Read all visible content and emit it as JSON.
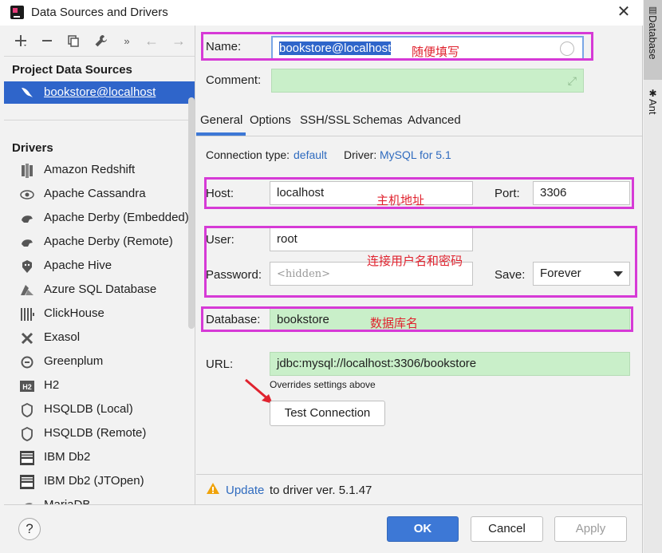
{
  "window": {
    "title": "Data Sources and Drivers"
  },
  "left": {
    "project_title": "Project Data Sources",
    "selected_source": "bookstore@localhost",
    "drivers_title": "Drivers",
    "drivers": [
      {
        "label": "Amazon Redshift",
        "icon": "redshift-icon"
      },
      {
        "label": "Apache Cassandra",
        "icon": "cassandra-icon"
      },
      {
        "label": "Apache Derby (Embedded)",
        "icon": "derby-icon"
      },
      {
        "label": "Apache Derby (Remote)",
        "icon": "derby-icon"
      },
      {
        "label": "Apache Hive",
        "icon": "hive-icon"
      },
      {
        "label": "Azure SQL Database",
        "icon": "azure-icon"
      },
      {
        "label": "ClickHouse",
        "icon": "clickhouse-icon"
      },
      {
        "label": "Exasol",
        "icon": "exasol-icon"
      },
      {
        "label": "Greenplum",
        "icon": "greenplum-icon"
      },
      {
        "label": "H2",
        "icon": "h2-icon"
      },
      {
        "label": "HSQLDB (Local)",
        "icon": "hsqldb-icon"
      },
      {
        "label": "HSQLDB (Remote)",
        "icon": "hsqldb-icon"
      },
      {
        "label": "IBM Db2",
        "icon": "db2-icon"
      },
      {
        "label": "IBM Db2 (JTOpen)",
        "icon": "db2-icon"
      },
      {
        "label": "MariaDB",
        "icon": "mariadb-icon"
      }
    ]
  },
  "form": {
    "name_label": "Name:",
    "name_value": "bookstore@localhost",
    "name_note": "随便填写",
    "comment_label": "Comment:",
    "tabs": [
      "General",
      "Options",
      "SSH/SSL",
      "Schemas",
      "Advanced"
    ],
    "conn_type_label": "Connection type:",
    "conn_type_value": "default",
    "driver_label": "Driver:",
    "driver_value": "MySQL for 5.1",
    "host_label": "Host:",
    "host_value": "localhost",
    "host_note": "主机地址",
    "port_label": "Port:",
    "port_value": "3306",
    "user_label": "User:",
    "user_value": "root",
    "password_label": "Password:",
    "password_placeholder": "<hidden>",
    "cred_note": "连接用户名和密码",
    "save_label": "Save:",
    "save_value": "Forever",
    "database_label": "Database:",
    "database_value": "bookstore",
    "database_note": "数据库名",
    "url_label": "URL:",
    "url_value": "jdbc:mysql://localhost:3306/bookstore",
    "url_hint": "Overrides settings above",
    "test_button": "Test Connection",
    "update_link": "Update",
    "update_text": "to driver ver. 5.1.47"
  },
  "footer": {
    "help": "?",
    "ok": "OK",
    "cancel": "Cancel",
    "apply": "Apply"
  },
  "side": {
    "database_tab": "Database",
    "ant_tab": "Ant"
  },
  "colors": {
    "accent": "#2f65ca",
    "highlight_box": "#d63ad6",
    "annotation": "#e0232f",
    "field_green": "#c9efc9"
  }
}
